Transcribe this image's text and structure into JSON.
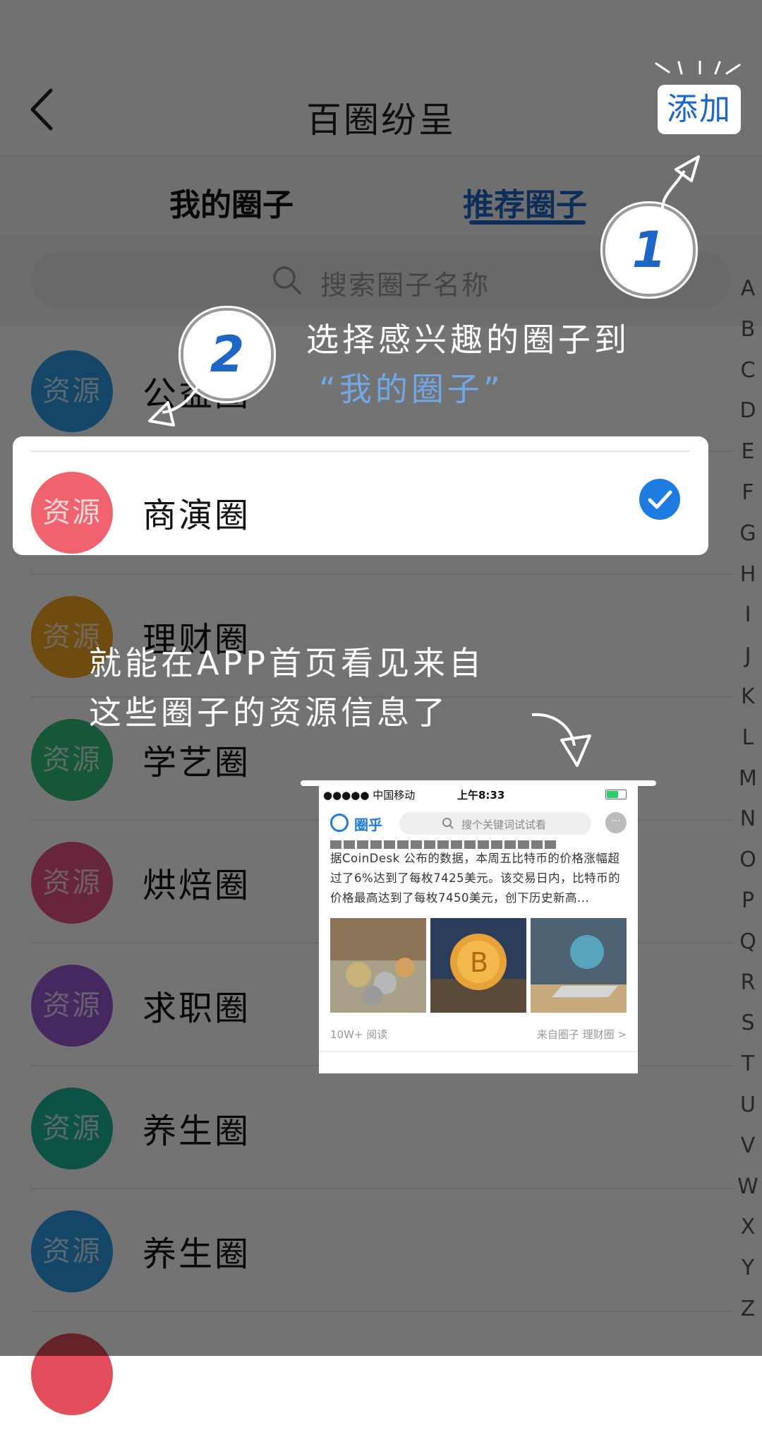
{
  "nav": {
    "title": "百圈纷呈",
    "add_label": "添加"
  },
  "tabs": [
    {
      "label": "我的圈子"
    },
    {
      "label": "推荐圈子"
    }
  ],
  "search": {
    "placeholder": "搜索圈子名称"
  },
  "avatar_text": "资源",
  "circles": [
    {
      "name": "公益圈",
      "color": "#2e9be6"
    },
    {
      "name": "商演圈",
      "color": "#f0636e",
      "selected": true
    },
    {
      "name": "理财圈",
      "color": "#f4a623"
    },
    {
      "name": "学艺圈",
      "color": "#2fc27a"
    },
    {
      "name": "烘焙圈",
      "color": "#e4538a"
    },
    {
      "name": "求职圈",
      "color": "#9b59d6"
    },
    {
      "name": "养生圈",
      "color": "#1fb59c"
    },
    {
      "name": "养生圈",
      "color": "#2e9be6"
    }
  ],
  "index_letters": [
    "A",
    "B",
    "C",
    "D",
    "E",
    "F",
    "G",
    "H",
    "I",
    "J",
    "K",
    "L",
    "M",
    "N",
    "O",
    "P",
    "Q",
    "R",
    "S",
    "T",
    "U",
    "V",
    "W",
    "X",
    "Y",
    "Z"
  ],
  "guide": {
    "step1": "1",
    "step2": "2",
    "text1_line1": "选择感兴趣的圈子到",
    "text1_quote": "“我的圈子”",
    "text2_line1": "就能在APP首页看见来自",
    "text2_line2": "这些圈子的资源信息了"
  },
  "preview": {
    "carrier": "●●●●● 中国移动",
    "time": "上午8:33",
    "app_name": "圈乎",
    "search_placeholder": "搜个关键词试试看",
    "article": "据CoinDesk 公布的数据，本周五比特币的价格涨幅超过了6%达到了每枚7425美元。该交易日内，比特币的价格最高达到了每枚7450美元，创下历史新高...",
    "reads": "10W+ 阅读",
    "source": "来自圈子 理财圈 >"
  }
}
